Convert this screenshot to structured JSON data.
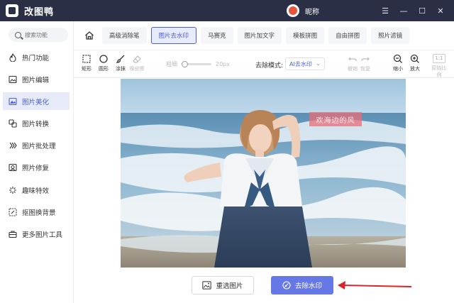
{
  "app": {
    "title": "改图鸭",
    "user_name": "昵称"
  },
  "window_controls": {
    "menu": "☰",
    "minimize": "—",
    "maximize": "☐",
    "close": "✕"
  },
  "sidebar": {
    "search_placeholder": "搜索功能",
    "items": [
      {
        "label": "热门功能",
        "icon": "hot-icon"
      },
      {
        "label": "图片编辑",
        "icon": "image-edit-icon"
      },
      {
        "label": "图片美化",
        "icon": "image-beautify-icon",
        "active": true
      },
      {
        "label": "图片转换",
        "icon": "convert-icon"
      },
      {
        "label": "图片批处理",
        "icon": "batch-icon"
      },
      {
        "label": "照片修复",
        "icon": "repair-icon"
      },
      {
        "label": "趣味特效",
        "icon": "effects-icon"
      },
      {
        "label": "抠图换背景",
        "icon": "cutout-icon"
      },
      {
        "label": "更多图片工具",
        "icon": "toolbox-icon"
      }
    ]
  },
  "tabs": [
    {
      "label": "高级消除笔"
    },
    {
      "label": "图片去水印",
      "active": true
    },
    {
      "label": "马赛克"
    },
    {
      "label": "图片加文字"
    },
    {
      "label": "模板拼图"
    },
    {
      "label": "自由拼图"
    },
    {
      "label": "照片滤镜"
    }
  ],
  "toolbar": {
    "rect": "矩形",
    "circle": "圆形",
    "brush": "涂抹",
    "eraser": "橡皮擦",
    "brush_size_label": "粗细",
    "brush_size_value": "20px",
    "mode_label": "去除模式:",
    "mode_value": "AI去水印",
    "undo": "撤销",
    "redo": "恢复",
    "zoom_out": "缩小",
    "zoom_in": "放大",
    "ratio_badge": "1:1",
    "ratio_label": "原始比例"
  },
  "canvas": {
    "watermark_text": "欢海边的风"
  },
  "actions": {
    "reselect_label": "重选图片",
    "remove_label": "去除水印"
  },
  "colors": {
    "accent": "#4a5ed8",
    "primary_button": "#6678e6",
    "titlebar": "#2a2f45",
    "arrow": "#d9262b"
  }
}
